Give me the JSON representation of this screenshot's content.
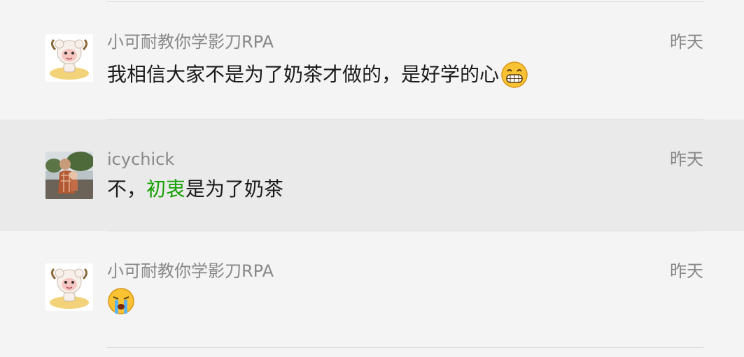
{
  "comments": [
    {
      "author": "小可耐教你学影刀RPA",
      "time": "昨天",
      "message": "我相信大家不是为了奶茶才做的，是好学的心",
      "emoji": "grin-emoji",
      "avatar": "sheep-avatar"
    },
    {
      "author": "icychick",
      "time": "昨天",
      "message_parts": [
        "不，",
        "初衷",
        "是为了奶茶"
      ],
      "avatar": "photo-avatar",
      "highlight_color": "#13a000"
    },
    {
      "author": "小可耐教你学影刀RPA",
      "time": "昨天",
      "emoji": "crying-emoji",
      "avatar": "sheep-avatar"
    }
  ],
  "colors": {
    "background": "#f4f4f4",
    "highlight_row": "#eaeaea",
    "meta_text": "#888888",
    "body_text": "#1a1a1a",
    "divider": "#dcdcdc"
  }
}
